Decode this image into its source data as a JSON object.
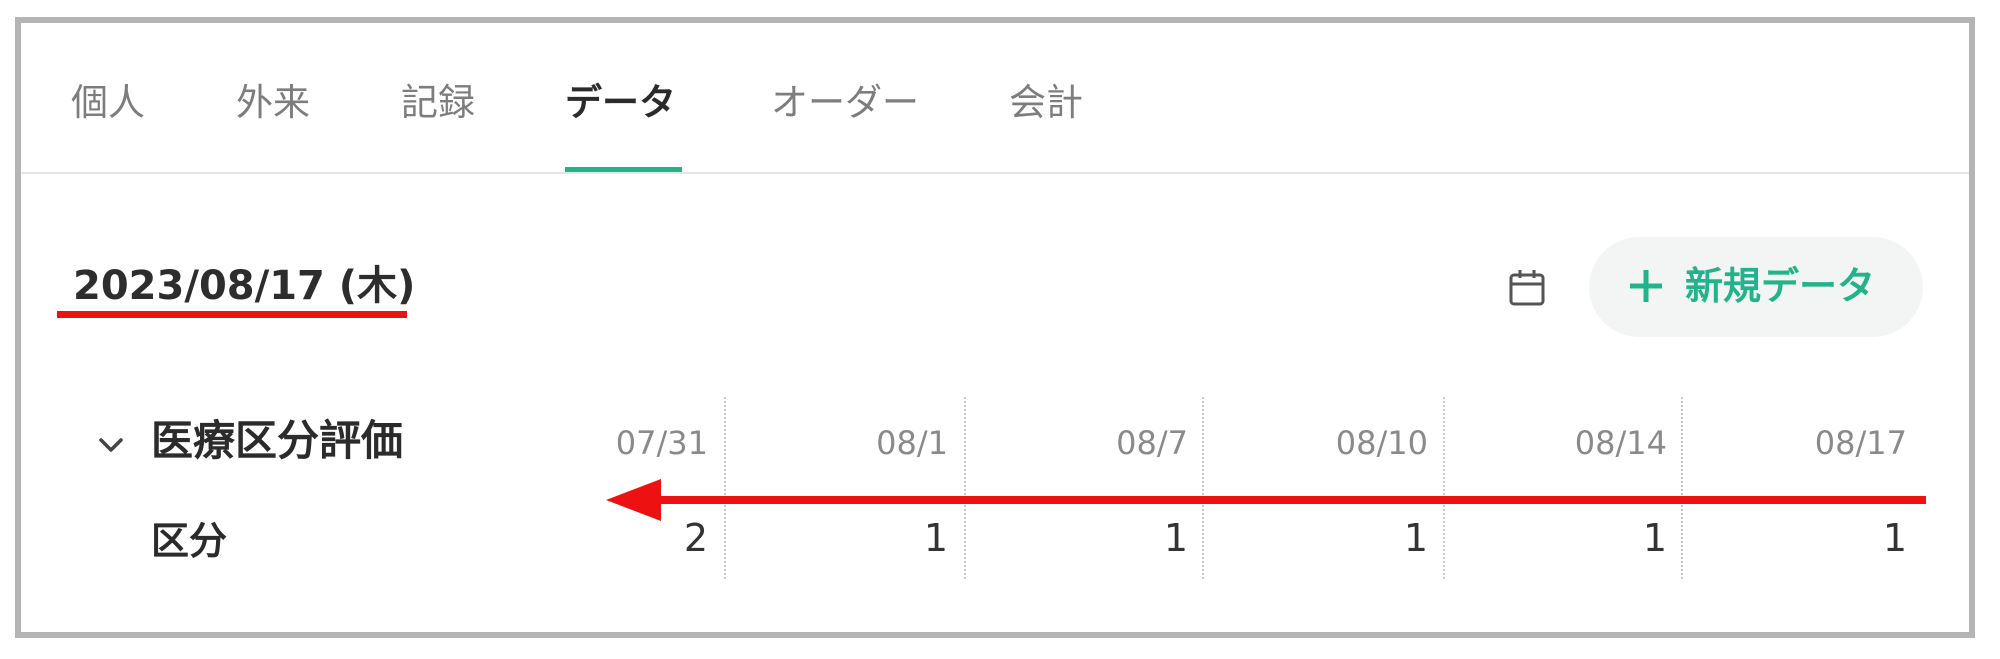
{
  "tabs": [
    {
      "label": "個人",
      "active": false
    },
    {
      "label": "外来",
      "active": false
    },
    {
      "label": "記録",
      "active": false
    },
    {
      "label": "データ",
      "active": true
    },
    {
      "label": "オーダー",
      "active": false
    },
    {
      "label": "会計",
      "active": false
    }
  ],
  "date": "2023/08/17 (木)",
  "new_data_label": "新規データ",
  "section": {
    "title": "医療区分評価",
    "row_label": "区分",
    "dates": [
      "07/31",
      "08/1",
      "08/7",
      "08/10",
      "08/14",
      "08/17"
    ],
    "values": [
      "2",
      "1",
      "1",
      "1",
      "1",
      "1"
    ]
  },
  "colors": {
    "accent": "#23b38a",
    "annotation": "#ee1111",
    "frame": "#b4b4b4"
  },
  "icons": [
    "calendar-icon",
    "plus-icon",
    "chevron-down-icon",
    "arrow-left-annotation"
  ]
}
